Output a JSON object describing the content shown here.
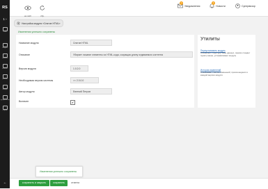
{
  "sidebar": {
    "logo": "RS",
    "add_label": "1 ›",
    "items": [
      {
        "label": "Сайт"
      },
      {
        "label": "Модули"
      },
      {
        "label": "Корзина"
      },
      {
        "label": "Каталог"
      },
      {
        "label": "Контент"
      },
      {
        "label": "Товары"
      },
      {
        "label": "Оформление"
      },
      {
        "label": "Сервис"
      }
    ],
    "collapse_label": "←"
  },
  "topbar": {
    "view_label": "на сайт",
    "refresh_label": "сбр.",
    "notifications_label": "Уведомления",
    "notifications_count": "1",
    "news_label": "Новости",
    "news_count": "1",
    "user_label": "Супервизор"
  },
  "module_chip": {
    "label": "Настройка модуля «Снятие HTML»"
  },
  "success_message": "Изменения успешно сохранены",
  "form": {
    "fields": [
      {
        "label": "Название модуля",
        "value": "Снятие HTML"
      },
      {
        "label": "Описание",
        "value": "Убирает лишние элементы из HTML-кода, сокращая длину отдаваемого контента"
      },
      {
        "label": "Версия модуля",
        "value": "1.0.2.0"
      },
      {
        "label": "Необходимая версия системы",
        "value": ">= 2.0.0.0"
      },
      {
        "label": "Автор модуля",
        "value": "Евгений Петров"
      }
    ],
    "enabled_label": "Включен",
    "enabled_mark": "✔"
  },
  "utilities": {
    "title": "Утилиты",
    "items": [
      {
        "link": "Переустановить модуль",
        "desc": "Обновляет структуру базы данных, заново создает пункты меню, устанавливает модуль"
      },
      {
        "link": "История изменений",
        "desc": "Показывает список изменений, произошедших в каждой версии модуля"
      }
    ]
  },
  "toast": {
    "message": "Изменения успешно сохранены"
  },
  "bottombar": {
    "save_close_label": "сохранить и закрыть",
    "save_label": "сохранить",
    "cancel_label": "отмена"
  },
  "colors": {
    "accent": "#2e9e3f",
    "sidebar": "#1c1c1c",
    "link": "#2a6ebb",
    "badge": "#f5a623"
  }
}
